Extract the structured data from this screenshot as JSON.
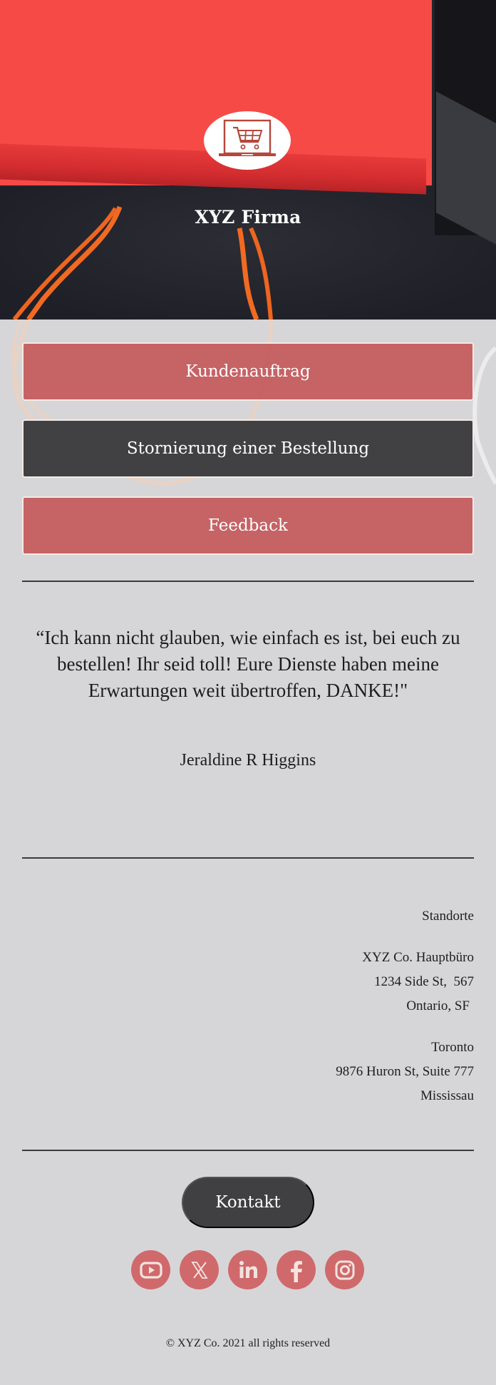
{
  "header": {
    "brand_name": "XYZ Firma",
    "logo_icon": "shopping-cart-laptop-icon"
  },
  "actions": [
    {
      "label": "Kundenauftrag",
      "style": "red"
    },
    {
      "label": "Stornierung einer Bestellung",
      "style": "dark"
    },
    {
      "label": "Feedback",
      "style": "red"
    }
  ],
  "testimonial": {
    "quote": "“Ich kann nicht glauben, wie einfach es ist, bei euch zu bestellen! Ihr seid toll! Eure Dienste haben meine Erwartungen weit übertroffen, DANKE!\"",
    "author": "Jeraldine R Higgins"
  },
  "locations": {
    "title": "Standorte",
    "offices": [
      {
        "name": "XYZ Co. Hauptbüro",
        "line1": "1234 Side St,  567",
        "line2": "Ontario, SF"
      },
      {
        "name": "Toronto",
        "line1": "9876 Huron St, Suite 777",
        "line2": "Mississau"
      }
    ]
  },
  "footer": {
    "contact_label": "Kontakt",
    "socials": [
      {
        "name": "youtube",
        "icon": "youtube-icon"
      },
      {
        "name": "x",
        "icon": "x-icon"
      },
      {
        "name": "linkedin",
        "icon": "linkedin-icon"
      },
      {
        "name": "facebook",
        "icon": "facebook-icon"
      },
      {
        "name": "instagram",
        "icon": "instagram-icon"
      }
    ],
    "copyright": "© XYZ Co. 2021 all rights reserved"
  },
  "colors": {
    "accent_red": "#c45e60",
    "dark_button": "#414143",
    "social_red": "#d0696b",
    "page_background": "#d6d6d8"
  }
}
